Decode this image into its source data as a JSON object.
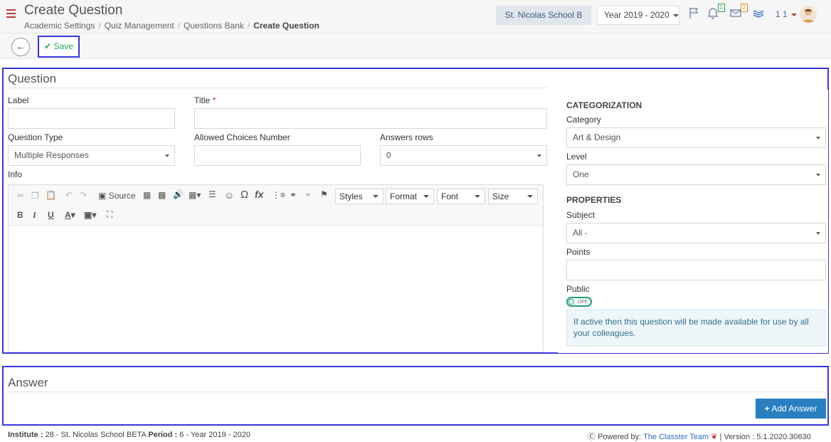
{
  "header": {
    "page_title": "Create Question",
    "breadcrumb": [
      "Academic Settings",
      "Quiz Management",
      "Questions Bank",
      "Create Question"
    ],
    "school": "St. Nicolas School B",
    "year": "Year 2019 - 2020",
    "notif_badge": "1",
    "mail_badge": "2",
    "user_num": "1 1",
    "colors": {
      "accent": "#3b34e1",
      "menu": "#c0392b"
    }
  },
  "toolbar": {
    "save_label": "Save"
  },
  "question": {
    "title": "Question",
    "label_label": "Label",
    "title_label": "Title",
    "required_mark": "*",
    "qtype_label": "Question Type",
    "qtype_value": "Multiple Responses",
    "allowed_label": "Allowed Choices Number",
    "rows_label": "Answers rows",
    "rows_value": "0",
    "info_label": "Info"
  },
  "editor": {
    "source": "Source",
    "styles": "Styles",
    "format": "Format",
    "font": "Font",
    "size": "Size"
  },
  "right": {
    "categorization": "CATEGORIZATION",
    "category_label": "Category",
    "category_value": "Art & Design",
    "level_label": "Level",
    "level_value": "One",
    "properties": "PROPERTIES",
    "subject_label": "Subject",
    "subject_value": "All -",
    "points_label": "Points",
    "public_label": "Public",
    "toggle_text": "OFF",
    "note": "If active then this question will be made available for use by all your colleagues."
  },
  "answer": {
    "title": "Answer",
    "add_label": "Add Answer"
  },
  "footer": {
    "institute_label": "Institute :",
    "institute_value": "28 - St. Nicolas School BETA",
    "period_label": "Period :",
    "period_value": "6 - Year 2019 - 2020",
    "powered": "Powered by:",
    "team": "The Classter Team",
    "version": "| Version : 5.1.2020.30630"
  }
}
